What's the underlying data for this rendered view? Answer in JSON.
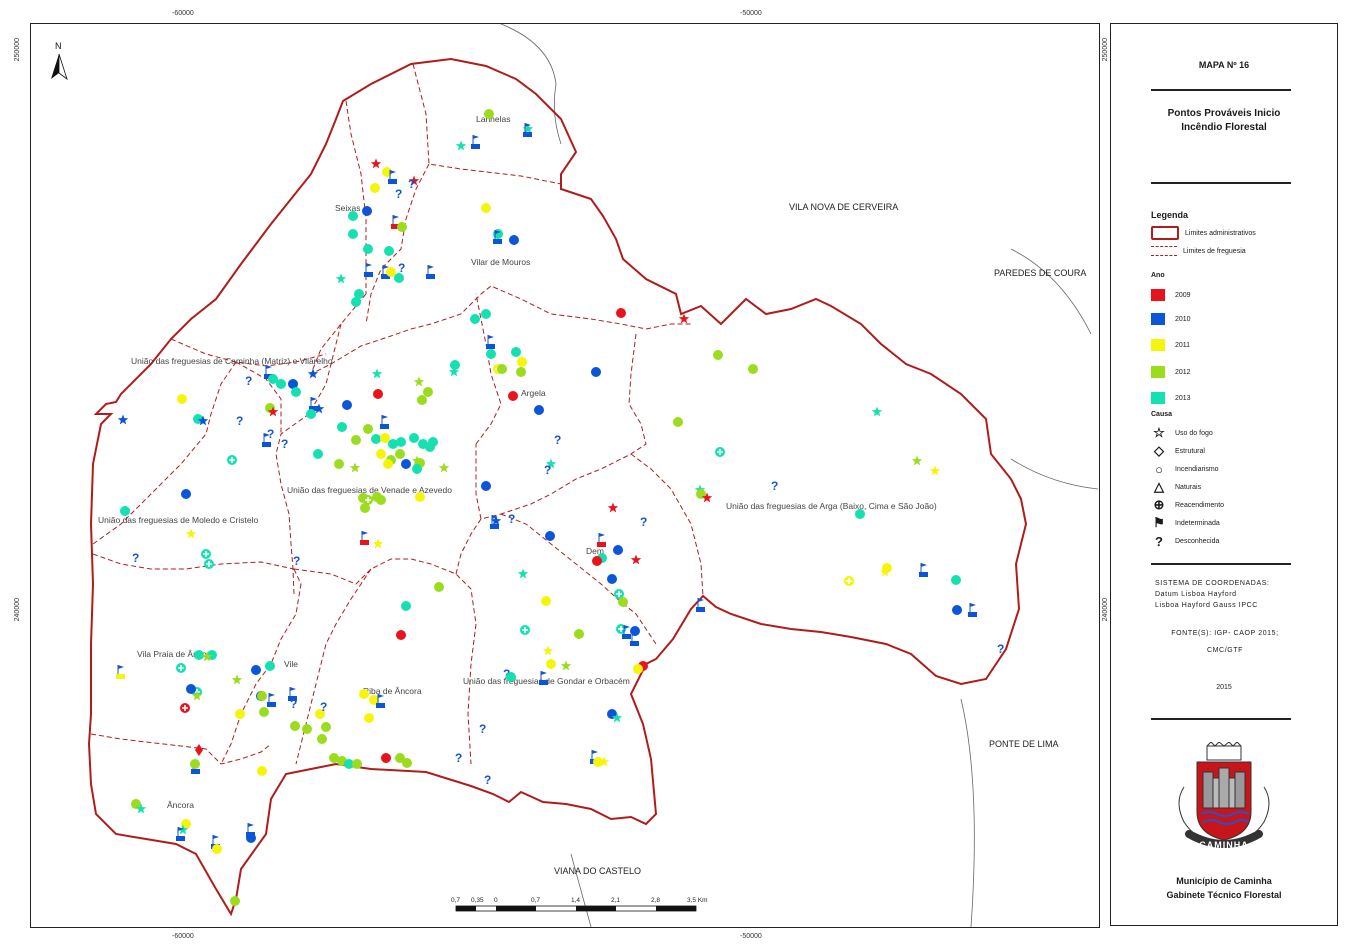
{
  "map": {
    "north_label": "N",
    "coords_top": [
      "-60000",
      "-50000"
    ],
    "coords_bottom": [
      "-60000",
      "-50000"
    ],
    "coords_left": [
      "250000",
      "240000"
    ],
    "coords_right": [
      "250000",
      "240000"
    ],
    "places": {
      "lanhelas": "Lanhelas",
      "seixas": "Seixas",
      "vilar_mouros": "Vilar de Mouros",
      "caminha_matriz": "União das freguesias de Caminha (Matriz) e Vilarelho",
      "argela": "Argela",
      "venade_azevedo": "União das freguesias de Venade e Azevedo",
      "moledo_cristelo": "União das freguesias de Moledo e Cristelo",
      "arga": "União das freguesias de Arga (Baixo, Cima e São João)",
      "dem": "Dem",
      "vila_praia_ancora": "Vila Praia de Âncora",
      "vile": "Vile",
      "riba_ancora": "Riba de Âncora",
      "gondar_orbacem": "União das freguesias de Gondar e Orbacém",
      "ancora": "Âncora"
    },
    "neighbours": {
      "vila_nova_cerveira": "VILA NOVA DE CERVEIRA",
      "paredes_coura": "PAREDES DE COURA",
      "ponte_lima": "PONTE DE LIMA",
      "viana_castelo": "VIANA DO CASTELO"
    },
    "scale": {
      "labels": [
        "0,7",
        "0,35",
        "0",
        "0,7",
        "1,4",
        "2,1",
        "2,8",
        "3,5 Km"
      ]
    }
  },
  "panel": {
    "map_number": "MAPA Nº 16",
    "title_line1": "Pontos Prováveis Inicio",
    "title_line2": "Incêndio Florestal",
    "legend_title": "Legenda",
    "boundary_admin": "Limites administrativos",
    "boundary_parish": "Limites de freguesia",
    "year_title": "Ano",
    "years": [
      {
        "label": "2009",
        "color": "#e8141b"
      },
      {
        "label": "2010",
        "color": "#0a55d8"
      },
      {
        "label": "2011",
        "color": "#f5f50a"
      },
      {
        "label": "2012",
        "color": "#9cdc1e"
      },
      {
        "label": "2013",
        "color": "#15e0b0"
      }
    ],
    "cause_title": "Causa",
    "causes": [
      {
        "label": "Uso do fogo",
        "icon": "star-icon"
      },
      {
        "label": "Estrutural",
        "icon": "diamond-icon"
      },
      {
        "label": "Incendiarismo",
        "icon": "circle-icon"
      },
      {
        "label": "Naturais",
        "icon": "triangle-icon"
      },
      {
        "label": "Reacendimento",
        "icon": "plus-circle-icon"
      },
      {
        "label": "Indeterminada",
        "icon": "flag-icon"
      },
      {
        "label": "Desconhecida",
        "icon": "question-icon"
      }
    ],
    "coord_system": [
      "SISTEMA DE COORDENADAS:",
      "Datum Lisboa Hayford",
      "Lisboa Hayford Gauss IPCC"
    ],
    "sources": [
      "FONTE(S): IGP- CAOP 2015;",
      "CMC/GTF"
    ],
    "year_made": "2015",
    "crest_text": "CAMINHA",
    "footer_line1": "Município de Caminha",
    "footer_line2": "Gabinete Técnico Florestal"
  }
}
